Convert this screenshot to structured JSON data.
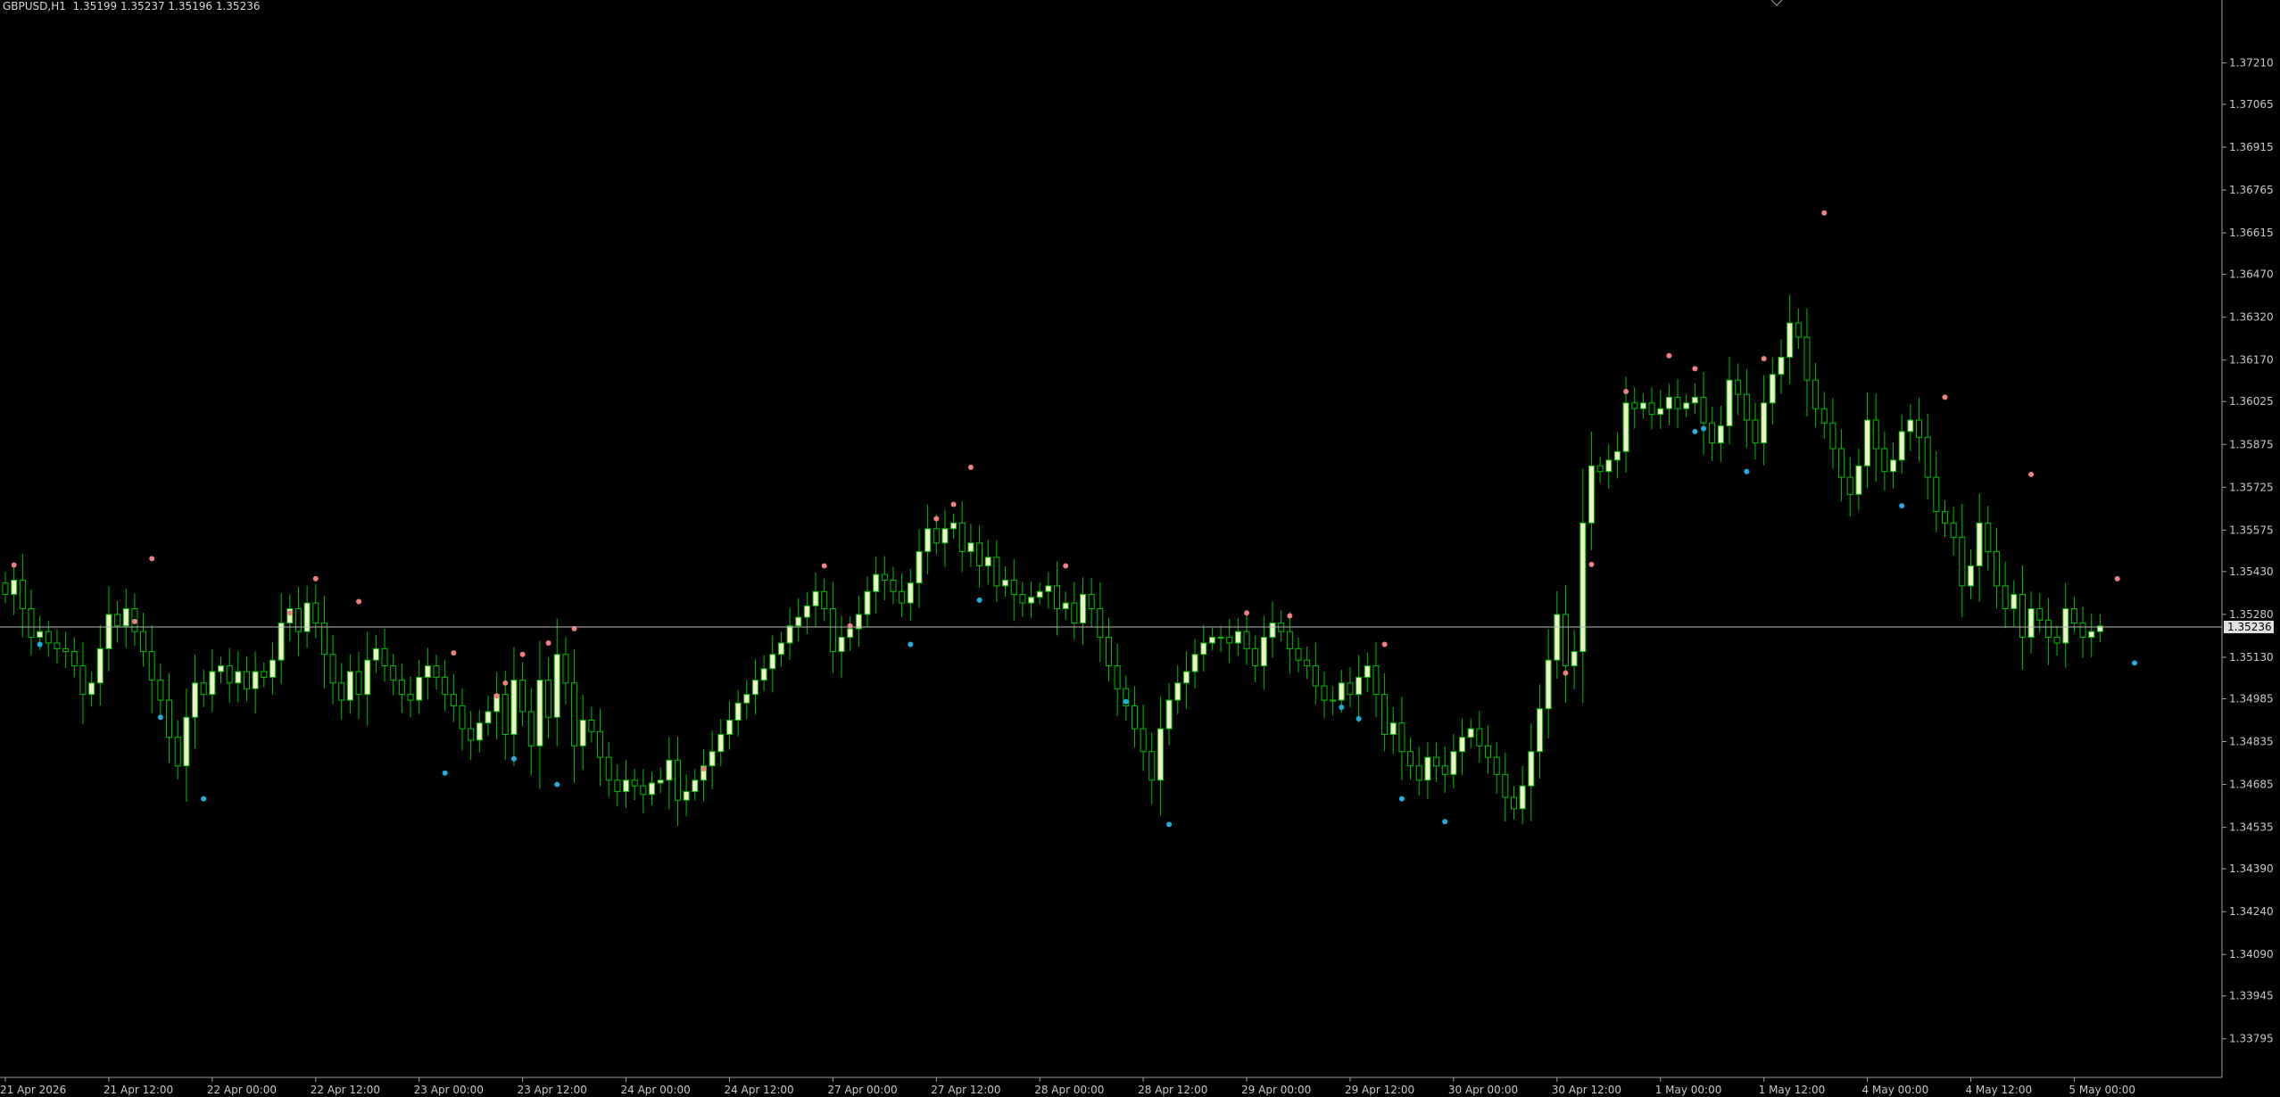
{
  "header": {
    "symbol": "GBPUSD,H1",
    "ohlc": "1.35199 1.35237 1.35196 1.35236"
  },
  "current_price_label": "1.35236",
  "colors": {
    "background": "#000000",
    "bull_body": "#f0f0c8",
    "bear_body": "#000000",
    "wick": "#00c000",
    "grid_axis": "#a0a0a0",
    "price_line": "#b8b8b8",
    "fractal_up": "#f08080",
    "fractal_down": "#20b0e0"
  },
  "chart_data": {
    "type": "candlestick",
    "title": "",
    "xlabel": "",
    "ylabel": "",
    "ylim": [
      1.3366,
      1.3743
    ],
    "current_price": 1.35236,
    "y_ticks": [
      "1.37210",
      "1.37065",
      "1.36915",
      "1.36765",
      "1.36615",
      "1.36470",
      "1.36320",
      "1.36170",
      "1.36025",
      "1.35875",
      "1.35725",
      "1.35575",
      "1.35430",
      "1.35280",
      "1.35130",
      "1.34985",
      "1.34835",
      "1.34685",
      "1.34535",
      "1.34390",
      "1.34240",
      "1.34090",
      "1.33945",
      "1.33795"
    ],
    "x_ticks": [
      {
        "label": "21 Apr 2026",
        "bar": 0
      },
      {
        "label": "21 Apr 12:00",
        "bar": 12
      },
      {
        "label": "22 Apr 00:00",
        "bar": 24
      },
      {
        "label": "22 Apr 12:00",
        "bar": 36
      },
      {
        "label": "23 Apr 00:00",
        "bar": 48
      },
      {
        "label": "23 Apr 12:00",
        "bar": 60
      },
      {
        "label": "24 Apr 00:00",
        "bar": 72
      },
      {
        "label": "24 Apr 12:00",
        "bar": 84
      },
      {
        "label": "27 Apr 00:00",
        "bar": 96
      },
      {
        "label": "27 Apr 12:00",
        "bar": 108
      },
      {
        "label": "28 Apr 00:00",
        "bar": 120
      },
      {
        "label": "28 Apr 12:00",
        "bar": 132
      },
      {
        "label": "29 Apr 00:00",
        "bar": 144
      },
      {
        "label": "29 Apr 12:00",
        "bar": 156
      },
      {
        "label": "30 Apr 00:00",
        "bar": 168
      },
      {
        "label": "30 Apr 12:00",
        "bar": 180
      },
      {
        "label": "1 May 00:00",
        "bar": 192
      },
      {
        "label": "1 May 12:00",
        "bar": 204
      },
      {
        "label": "4 May 00:00",
        "bar": 216
      },
      {
        "label": "4 May 12:00",
        "bar": 228
      },
      {
        "label": "5 May 00:00",
        "bar": 240
      }
    ],
    "closes": [
      1.3535,
      1.354,
      1.353,
      1.352,
      1.3522,
      1.3518,
      1.3516,
      1.3515,
      1.351,
      1.35,
      1.3504,
      1.3516,
      1.3528,
      1.3524,
      1.353,
      1.3522,
      1.3515,
      1.3505,
      1.3498,
      1.3485,
      1.3475,
      1.3492,
      1.3504,
      1.35,
      1.3508,
      1.351,
      1.3504,
      1.3508,
      1.3502,
      1.3508,
      1.3506,
      1.3512,
      1.3525,
      1.353,
      1.3522,
      1.3532,
      1.3525,
      1.3514,
      1.3504,
      1.3498,
      1.3508,
      1.35,
      1.3512,
      1.3516,
      1.351,
      1.3505,
      1.35,
      1.3498,
      1.3506,
      1.351,
      1.3506,
      1.35,
      1.3496,
      1.3488,
      1.3484,
      1.349,
      1.3494,
      1.35,
      1.3486,
      1.3505,
      1.3494,
      1.3482,
      1.3505,
      1.3492,
      1.3514,
      1.3504,
      1.3482,
      1.3491,
      1.3487,
      1.3478,
      1.347,
      1.3466,
      1.347,
      1.3468,
      1.3465,
      1.3469,
      1.347,
      1.3477,
      1.3463,
      1.3466,
      1.347,
      1.3475,
      1.348,
      1.3486,
      1.3491,
      1.3497,
      1.35,
      1.3505,
      1.3509,
      1.3514,
      1.3518,
      1.3524,
      1.3527,
      1.3531,
      1.3536,
      1.353,
      1.3515,
      1.352,
      1.3523,
      1.3528,
      1.3536,
      1.3542,
      1.354,
      1.3536,
      1.3532,
      1.3539,
      1.355,
      1.3558,
      1.3553,
      1.3558,
      1.356,
      1.355,
      1.3553,
      1.3545,
      1.3548,
      1.3538,
      1.354,
      1.3535,
      1.3532,
      1.3534,
      1.3536,
      1.3538,
      1.353,
      1.3532,
      1.3525,
      1.3535,
      1.353,
      1.352,
      1.351,
      1.3502,
      1.3496,
      1.3488,
      1.348,
      1.347,
      1.3488,
      1.3498,
      1.3504,
      1.3508,
      1.3514,
      1.3518,
      1.352,
      1.352,
      1.3518,
      1.3522,
      1.3516,
      1.351,
      1.352,
      1.3525,
      1.3522,
      1.3516,
      1.3512,
      1.351,
      1.3503,
      1.3498,
      1.3498,
      1.3504,
      1.35,
      1.3506,
      1.351,
      1.35,
      1.3486,
      1.349,
      1.348,
      1.3475,
      1.347,
      1.3478,
      1.3475,
      1.3472,
      1.348,
      1.3485,
      1.3488,
      1.3482,
      1.3478,
      1.3472,
      1.3464,
      1.346,
      1.3468,
      1.348,
      1.3495,
      1.3512,
      1.3528,
      1.351,
      1.3515,
      1.356,
      1.358,
      1.3578,
      1.3582,
      1.3585,
      1.3602,
      1.36,
      1.3602,
      1.3598,
      1.36,
      1.3604,
      1.36,
      1.3602,
      1.3604,
      1.3595,
      1.3588,
      1.3594,
      1.361,
      1.3605,
      1.3596,
      1.3588,
      1.3602,
      1.3612,
      1.3618,
      1.363,
      1.3625,
      1.361,
      1.36,
      1.3595,
      1.3586,
      1.3576,
      1.357,
      1.358,
      1.3596,
      1.3586,
      1.3578,
      1.3582,
      1.3592,
      1.3596,
      1.359,
      1.3576,
      1.3564,
      1.356,
      1.3555,
      1.3538,
      1.3545,
      1.356,
      1.355,
      1.3538,
      1.353,
      1.3535,
      1.352,
      1.353,
      1.3526,
      1.352,
      1.3518,
      1.353,
      1.3525,
      1.352,
      1.3522,
      1.3524
    ],
    "fractals_up": [
      {
        "bar": 1,
        "price": 1.35453
      },
      {
        "bar": 15,
        "price": 1.35255
      },
      {
        "bar": 17,
        "price": 1.35475
      },
      {
        "bar": 33,
        "price": 1.35285
      },
      {
        "bar": 36,
        "price": 1.35405
      },
      {
        "bar": 41,
        "price": 1.35325
      },
      {
        "bar": 52,
        "price": 1.35145
      },
      {
        "bar": 57,
        "price": 1.34995
      },
      {
        "bar": 58,
        "price": 1.3504
      },
      {
        "bar": 60,
        "price": 1.3514
      },
      {
        "bar": 63,
        "price": 1.3518
      },
      {
        "bar": 66,
        "price": 1.3523
      },
      {
        "bar": 81,
        "price": 1.3474
      },
      {
        "bar": 95,
        "price": 1.3545
      },
      {
        "bar": 98,
        "price": 1.3524
      },
      {
        "bar": 108,
        "price": 1.35615
      },
      {
        "bar": 110,
        "price": 1.35665
      },
      {
        "bar": 112,
        "price": 1.35795
      },
      {
        "bar": 123,
        "price": 1.3545
      },
      {
        "bar": 144,
        "price": 1.35285
      },
      {
        "bar": 149,
        "price": 1.35275
      },
      {
        "bar": 160,
        "price": 1.35175
      },
      {
        "bar": 181,
        "price": 1.35075
      },
      {
        "bar": 184,
        "price": 1.35455
      },
      {
        "bar": 188,
        "price": 1.3606
      },
      {
        "bar": 193,
        "price": 1.36185
      },
      {
        "bar": 196,
        "price": 1.3614
      },
      {
        "bar": 204,
        "price": 1.36175
      },
      {
        "bar": 211,
        "price": 1.36685
      },
      {
        "bar": 225,
        "price": 1.3604
      },
      {
        "bar": 235,
        "price": 1.3577
      },
      {
        "bar": 245,
        "price": 1.35405
      }
    ],
    "fractals_down": [
      {
        "bar": 4,
        "price": 1.35175
      },
      {
        "bar": 18,
        "price": 1.3492
      },
      {
        "bar": 23,
        "price": 1.34635
      },
      {
        "bar": 51,
        "price": 1.34725
      },
      {
        "bar": 59,
        "price": 1.34775
      },
      {
        "bar": 64,
        "price": 1.34685
      },
      {
        "bar": 105,
        "price": 1.35175
      },
      {
        "bar": 113,
        "price": 1.3533
      },
      {
        "bar": 130,
        "price": 1.34975
      },
      {
        "bar": 135,
        "price": 1.34545
      },
      {
        "bar": 155,
        "price": 1.34955
      },
      {
        "bar": 157,
        "price": 1.34915
      },
      {
        "bar": 162,
        "price": 1.34635
      },
      {
        "bar": 167,
        "price": 1.34555
      },
      {
        "bar": 196,
        "price": 1.3592
      },
      {
        "bar": 197,
        "price": 1.3593
      },
      {
        "bar": 202,
        "price": 1.3578
      },
      {
        "bar": 220,
        "price": 1.3566
      },
      {
        "bar": 247,
        "price": 1.3511
      }
    ]
  }
}
